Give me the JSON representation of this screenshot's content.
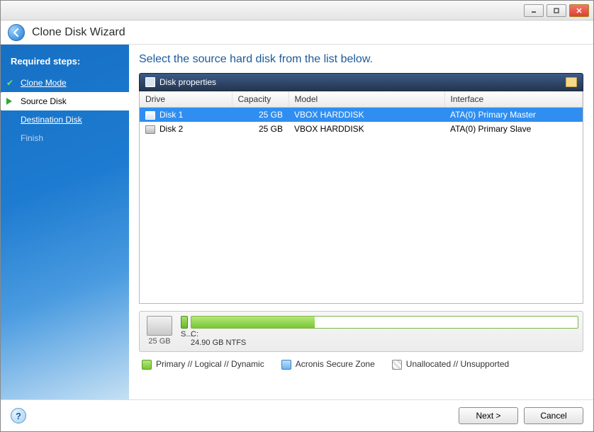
{
  "window": {
    "title": "Clone Disk Wizard"
  },
  "sidebar": {
    "heading": "Required steps:",
    "steps": [
      {
        "label": "Clone Mode",
        "state": "done"
      },
      {
        "label": "Source Disk",
        "state": "current"
      },
      {
        "label": "Destination Disk",
        "state": "pending"
      },
      {
        "label": "Finish",
        "state": "disabled"
      }
    ]
  },
  "main": {
    "heading": "Select the source hard disk from the list below.",
    "propsbar_label": "Disk properties",
    "columns": {
      "drive": "Drive",
      "capacity": "Capacity",
      "model": "Model",
      "interface": "Interface"
    },
    "disks": [
      {
        "drive": "Disk 1",
        "capacity": "25 GB",
        "model": "VBOX HARDDISK",
        "interface": "ATA(0) Primary Master",
        "selected": true
      },
      {
        "drive": "Disk 2",
        "capacity": "25 GB",
        "model": "VBOX HARDDISK",
        "interface": "ATA(0) Primary Slave",
        "selected": false
      }
    ],
    "diskmap": {
      "total_label": "25 GB",
      "sysres_label": "S...",
      "partition_label": "C:",
      "partition_detail": "24.90 GB  NTFS",
      "fill_percent": 32
    },
    "legend": {
      "primary": "Primary // Logical // Dynamic",
      "secure": "Acronis Secure Zone",
      "unalloc": "Unallocated // Unsupported"
    }
  },
  "footer": {
    "next": "Next >",
    "cancel": "Cancel"
  }
}
